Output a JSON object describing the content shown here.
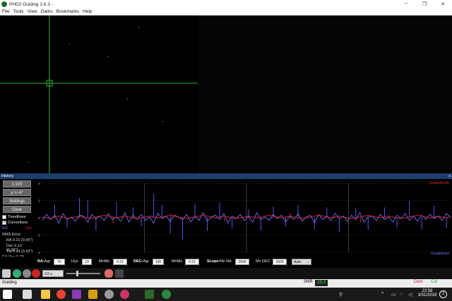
{
  "window": {
    "title": "PHD2 Guiding 2.6.3 -",
    "controls": [
      "─",
      "❐",
      "✕"
    ]
  },
  "menu": [
    "File",
    "Tools",
    "View",
    "Darks",
    "Bookmarks",
    "Help"
  ],
  "history": {
    "title": "History",
    "close": "x",
    "buttons": {
      "x_scale": "x:100",
      "y_scale": "y:+/-4\"",
      "settings": "Settings",
      "clear": "Clear"
    },
    "trendlines": {
      "label": "Trendlines",
      "checked": false
    },
    "corrections": {
      "label": "Corrections",
      "checked": true
    },
    "ra_label": "RA",
    "dec_label": "Dec",
    "rms_error": "RMS Error:",
    "rms_ra": "RA 0.21 (0.45\")",
    "rms_dec": "Dec 0.12 (0.26\")",
    "rms_tot": "Tot 0.24 (0.52\")",
    "ra_osc": "RA Osc 0.29",
    "guide_north": "GuideNorth",
    "guide_east": "GuideEast",
    "y_ticks": [
      "4\"",
      "2\"",
      "0\"",
      "-2\"",
      "-4\""
    ]
  },
  "controls": {
    "ra": {
      "label": "RA:",
      "agr_label": "Agr",
      "agr": "70",
      "hys_label": "Hys",
      "hys": "10",
      "mnmo_label": "MnMo",
      "mnmo": "0.22"
    },
    "dec": {
      "label": "DEC:",
      "agr_label": "Agr",
      "agr": "100",
      "mnmo_label": "MnMo",
      "mnmo": "0.22"
    },
    "scope": {
      "label": "Scope:",
      "mxra_label": "Mx RA",
      "mxra": "2500",
      "mxdec_label": "Mx DEC",
      "mxdec": "2500",
      "mode": "Auto"
    }
  },
  "toolbar": {
    "exposure": "3.0 s",
    "slider_fraction": 0.3
  },
  "status": {
    "text": "Guiding",
    "snr_label": "SNR",
    "snr": "15.3",
    "dark": "Dark",
    "cal": "Cal"
  },
  "taskbar": {
    "time": "22:58",
    "date": "3/31/2019",
    "notifications": "2"
  },
  "chart_data": {
    "type": "line",
    "title": "",
    "xlabel": "",
    "ylabel": "",
    "ylim": [
      -4,
      4
    ],
    "x_count": 100,
    "series": [
      {
        "name": "RA",
        "color": "#6a6aff",
        "values": [
          -0.3,
          0.4,
          -0.2,
          0.3,
          -0.6,
          0.5,
          -0.2,
          0.1,
          -0.4,
          0.3,
          0.2,
          -0.5,
          0.4,
          -0.1,
          0.2,
          -0.3,
          0.5,
          -0.2,
          0.1,
          -0.4,
          0.6,
          -0.5,
          0.3,
          -0.2,
          0.4,
          -0.3,
          0.1,
          -0.6,
          0.5,
          -0.1,
          0.2,
          -0.4,
          0.3,
          0.1,
          -0.2,
          0.4,
          -0.5,
          0.2,
          -0.3,
          0.6,
          -0.4,
          0.1,
          0.3,
          -0.2,
          0.5,
          -0.6,
          0.2,
          -0.1,
          0.4,
          -0.3,
          0.2,
          -0.5,
          0.6,
          -0.2,
          0.1,
          -0.3,
          0.4,
          -0.1,
          0.3,
          -0.5,
          0.2,
          -0.2,
          0.5,
          -0.4,
          0.1,
          0.3,
          -0.6,
          0.4,
          -0.2,
          0.2,
          -0.3,
          0.5,
          -0.1,
          0.2,
          -0.4,
          0.3,
          -0.2,
          0.6,
          -0.5,
          0.1,
          0.2,
          -0.3,
          0.4,
          -0.2,
          0.1,
          -0.5,
          0.3,
          -0.1,
          0.5,
          -0.3,
          0.2,
          -0.4,
          0.3,
          -0.2,
          0.4,
          -0.1,
          0.2,
          -0.3,
          0.5,
          0.1
        ]
      },
      {
        "name": "Dec",
        "color": "#dd2222",
        "values": [
          0.1,
          0.0,
          -0.1,
          0.1,
          0.2,
          0.1,
          -0.1,
          0.0,
          0.1,
          0.2,
          0.1,
          0.0,
          -0.1,
          0.1,
          0.2,
          0.3,
          0.2,
          0.1,
          0.0,
          0.1,
          0.2,
          0.1,
          0.0,
          -0.1,
          0.0,
          0.1,
          0.2,
          0.1,
          0.0,
          0.1,
          0.2,
          0.3,
          0.2,
          0.1,
          0.0,
          -0.1,
          0.0,
          0.1,
          0.2,
          0.3,
          0.2,
          0.1,
          0.0,
          0.1,
          0.2,
          0.1,
          0.0,
          -0.1,
          0.0,
          0.1,
          0.2,
          0.1,
          0.0,
          0.1,
          0.2,
          0.3,
          0.2,
          0.1,
          0.0,
          0.1,
          0.2,
          0.1,
          0.0,
          -0.1,
          0.0,
          0.1,
          0.2,
          0.3,
          0.2,
          0.1,
          0.0,
          0.1,
          0.2,
          0.1,
          0.0,
          -0.1,
          0.0,
          0.1,
          0.2,
          0.3,
          0.2,
          0.1,
          0.0,
          0.1,
          0.2,
          0.1,
          0.0,
          -0.1,
          0.0,
          0.1,
          0.2,
          0.3,
          0.2,
          0.1,
          0.0,
          0.1,
          0.2,
          0.1,
          0.0,
          0.1
        ]
      }
    ],
    "corrections": [
      {
        "x": 3,
        "v": 1.5
      },
      {
        "x": 6,
        "v": -1.2
      },
      {
        "x": 9,
        "v": 2.3
      },
      {
        "x": 11,
        "v": 2.0
      },
      {
        "x": 13,
        "v": -1.5
      },
      {
        "x": 18,
        "v": 1.8
      },
      {
        "x": 22,
        "v": 1.2
      },
      {
        "x": 24,
        "v": -1.0
      },
      {
        "x": 27,
        "v": 2.8
      },
      {
        "x": 29,
        "v": 1.5
      },
      {
        "x": 31,
        "v": -1.8
      },
      {
        "x": 34,
        "v": -2.5
      },
      {
        "x": 37,
        "v": 1.6
      },
      {
        "x": 40,
        "v": -1.5
      },
      {
        "x": 43,
        "v": 1.8
      },
      {
        "x": 46,
        "v": -1.2
      },
      {
        "x": 50,
        "v": 1.0
      },
      {
        "x": 53,
        "v": -1.5
      },
      {
        "x": 56,
        "v": 1.3
      },
      {
        "x": 59,
        "v": -1.0
      },
      {
        "x": 62,
        "v": 1.5
      },
      {
        "x": 66,
        "v": -1.3
      },
      {
        "x": 69,
        "v": 1.2
      },
      {
        "x": 72,
        "v": -1.6
      },
      {
        "x": 76,
        "v": 1.1
      },
      {
        "x": 79,
        "v": -1.4
      },
      {
        "x": 83,
        "v": 1.2
      },
      {
        "x": 86,
        "v": -1.1
      },
      {
        "x": 89,
        "v": 2.0
      },
      {
        "x": 92,
        "v": -1.3
      },
      {
        "x": 95,
        "v": 1.4
      },
      {
        "x": 98,
        "v": -1.2
      }
    ],
    "dec_corrections": [
      {
        "x": 17,
        "v": -0.6
      },
      {
        "x": 31,
        "v": 0.5
      },
      {
        "x": 44,
        "v": -0.4
      },
      {
        "x": 60,
        "v": 0.5
      },
      {
        "x": 77,
        "v": -0.5
      }
    ],
    "grid": true
  }
}
